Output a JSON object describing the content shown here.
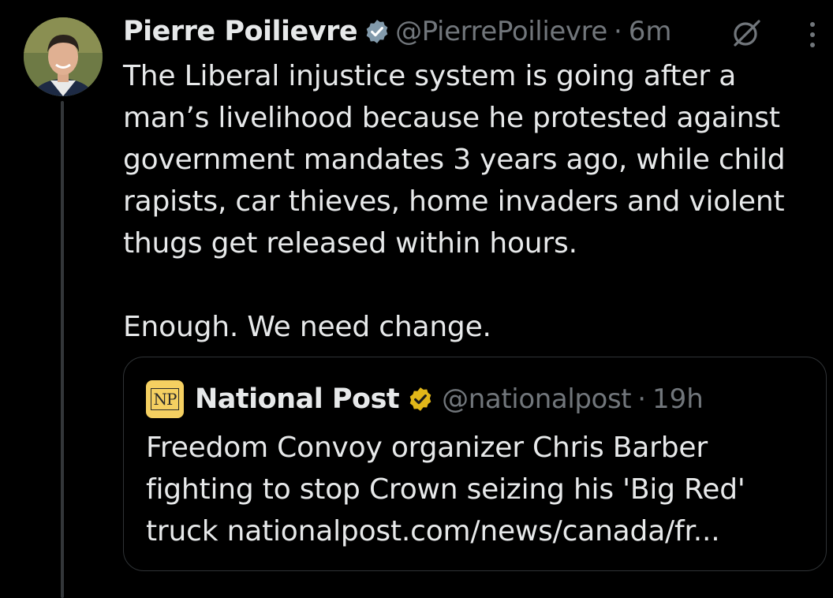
{
  "tweet": {
    "author_name": "Pierre Poilievre",
    "handle": "@PierrePoilievre",
    "separator": "·",
    "time": "6m",
    "body_lines": [
      "The Liberal injustice system is going after a",
      "man’s livelihood because he protested against",
      "government mandates 3 years ago, while child",
      "rapists, car thieves, home invaders and violent",
      "thugs get released within hours."
    ],
    "body_closing": "Enough. We need change."
  },
  "quoted_tweet": {
    "logo_text": "NP",
    "author_name": "National Post",
    "handle": "@nationalpost",
    "separator": "·",
    "time": "19h",
    "text_lines": [
      "Freedom Convoy organizer Chris Barber",
      "fighting to stop Crown seizing his 'Big Red'",
      "truck nationalpost.com/news/canada/fr..."
    ]
  },
  "icons": {
    "verified_author": "verified-badge-icon",
    "verified_quote": "gold-verified-badge-icon",
    "grok": "grok-icon",
    "more": "more-options-icon"
  },
  "colors": {
    "background": "#000000",
    "text": "#e7e9ea",
    "muted": "#71767b",
    "border": "#2f3336",
    "verified_grey": "#829aab",
    "verified_gold": "#e2b719"
  }
}
